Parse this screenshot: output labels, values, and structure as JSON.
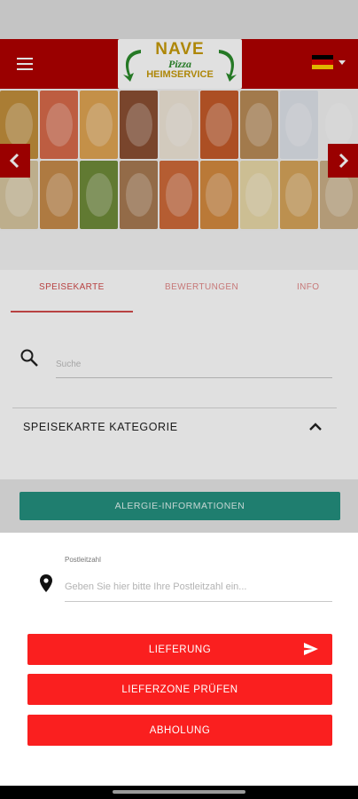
{
  "app_bar": {
    "logo": {
      "brand": "NAVE",
      "sub": "Pizza",
      "tag": "HEIMSERVICE"
    },
    "language": {
      "flag": "german-flag",
      "colors": [
        "#000000",
        "#dd0000",
        "#ffce00"
      ]
    },
    "icons": {
      "menu": "hamburger-menu-icon",
      "language_caret": "caret-down-icon"
    }
  },
  "gallery": {
    "prev_icon": "chevron-left-icon",
    "next_icon": "chevron-right-icon",
    "tiles": [
      {
        "color": "#c28f3c"
      },
      {
        "color": "#d86a4a"
      },
      {
        "color": "#e0a453"
      },
      {
        "color": "#8a4f33"
      },
      {
        "color": "#efe6d8"
      },
      {
        "color": "#c45a2a"
      },
      {
        "color": "#b98b57"
      },
      {
        "color": "#dfe3ea"
      },
      {
        "color": "#f2f2f2"
      },
      {
        "color": "#d8c7a0"
      },
      {
        "color": "#c78b4a"
      },
      {
        "color": "#6f8b3a"
      },
      {
        "color": "#a87a52"
      },
      {
        "color": "#cf6a3a"
      },
      {
        "color": "#d48a3f"
      },
      {
        "color": "#e9d9a8"
      },
      {
        "color": "#d7a45a"
      },
      {
        "color": "#cbb088"
      }
    ]
  },
  "tabs": [
    {
      "label": "SPEISEKARTE",
      "active": true
    },
    {
      "label": "BEWERTUNGEN",
      "active": false
    },
    {
      "label": "INFO",
      "active": false
    }
  ],
  "search": {
    "placeholder": "Suche",
    "value": "",
    "icon": "search-icon"
  },
  "category": {
    "label": "SPEISEKARTE KATEGORIE",
    "icon": "chevron-up-icon"
  },
  "allergy_button": {
    "label": "ALERGIE-INFORMATIONEN"
  },
  "sheet": {
    "postal_label": "Postleitzahl",
    "postal_placeholder": "Geben Sie hier bitte Ihre Postleitzahl ein...",
    "pin_icon": "map-pin-icon",
    "buttons": [
      {
        "label": "LIEFERUNG",
        "icon": "send-icon"
      },
      {
        "label": "LIEFERZONE PRÜFEN"
      },
      {
        "label": "ABHOLUNG"
      }
    ]
  },
  "colors": {
    "primary_red": "#b00000",
    "button_red": "#fa1f1f",
    "teal": "#24907f",
    "tab_active": "#d24c4c"
  }
}
